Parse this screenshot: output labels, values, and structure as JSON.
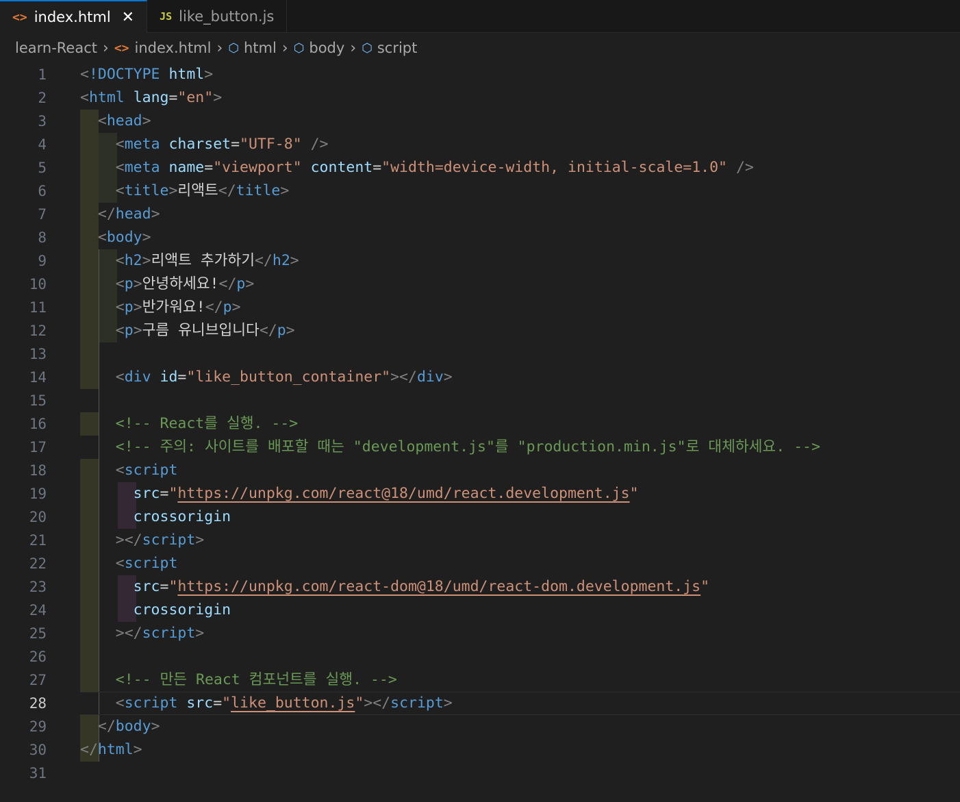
{
  "tabs": [
    {
      "icon": "<>",
      "label": "index.html",
      "close": "✕"
    },
    {
      "icon": "JS",
      "label": "like_button.js"
    }
  ],
  "breadcrumb": [
    "learn-React",
    "index.html",
    "html",
    "body",
    "script"
  ],
  "current_line": 28,
  "lines": [
    {
      "n": 1,
      "p": [
        [
          "pu",
          "<"
        ],
        [
          "tg",
          "!DOCTYPE"
        ],
        [
          "tx",
          " "
        ],
        [
          "at",
          "html"
        ],
        [
          "pu",
          ">"
        ]
      ]
    },
    {
      "n": 2,
      "p": [
        [
          "pu",
          "<"
        ],
        [
          "tg",
          "html"
        ],
        [
          "tx",
          " "
        ],
        [
          "at",
          "lang"
        ],
        [
          "tx",
          "="
        ],
        [
          "st",
          "\"en\""
        ],
        [
          "pu",
          ">"
        ]
      ]
    },
    {
      "n": 3,
      "p": [
        [
          "tx",
          "  "
        ],
        [
          "pu",
          "<"
        ],
        [
          "tg",
          "head"
        ],
        [
          "pu",
          ">"
        ]
      ]
    },
    {
      "n": 4,
      "p": [
        [
          "tx",
          "    "
        ],
        [
          "pu",
          "<"
        ],
        [
          "tg",
          "meta"
        ],
        [
          "tx",
          " "
        ],
        [
          "at",
          "charset"
        ],
        [
          "tx",
          "="
        ],
        [
          "st",
          "\"UTF-8\""
        ],
        [
          "tx",
          " "
        ],
        [
          "pu",
          "/>"
        ]
      ]
    },
    {
      "n": 5,
      "p": [
        [
          "tx",
          "    "
        ],
        [
          "pu",
          "<"
        ],
        [
          "tg",
          "meta"
        ],
        [
          "tx",
          " "
        ],
        [
          "at",
          "name"
        ],
        [
          "tx",
          "="
        ],
        [
          "st",
          "\"viewport\""
        ],
        [
          "tx",
          " "
        ],
        [
          "at",
          "content"
        ],
        [
          "tx",
          "="
        ],
        [
          "st",
          "\"width=device-width, initial-scale=1.0\""
        ],
        [
          "tx",
          " "
        ],
        [
          "pu",
          "/>"
        ]
      ]
    },
    {
      "n": 6,
      "p": [
        [
          "tx",
          "    "
        ],
        [
          "pu",
          "<"
        ],
        [
          "tg",
          "title"
        ],
        [
          "pu",
          ">"
        ],
        [
          "tx",
          "리액트"
        ],
        [
          "pu",
          "</"
        ],
        [
          "tg",
          "title"
        ],
        [
          "pu",
          ">"
        ]
      ]
    },
    {
      "n": 7,
      "p": [
        [
          "tx",
          "  "
        ],
        [
          "pu",
          "</"
        ],
        [
          "tg",
          "head"
        ],
        [
          "pu",
          ">"
        ]
      ]
    },
    {
      "n": 8,
      "p": [
        [
          "tx",
          "  "
        ],
        [
          "pu",
          "<"
        ],
        [
          "tg",
          "body"
        ],
        [
          "pu",
          ">"
        ]
      ]
    },
    {
      "n": 9,
      "p": [
        [
          "tx",
          "    "
        ],
        [
          "pu",
          "<"
        ],
        [
          "tg",
          "h2"
        ],
        [
          "pu",
          ">"
        ],
        [
          "tx",
          "리액트 추가하기"
        ],
        [
          "pu",
          "</"
        ],
        [
          "tg",
          "h2"
        ],
        [
          "pu",
          ">"
        ]
      ]
    },
    {
      "n": 10,
      "p": [
        [
          "tx",
          "    "
        ],
        [
          "pu",
          "<"
        ],
        [
          "tg",
          "p"
        ],
        [
          "pu",
          ">"
        ],
        [
          "tx",
          "안녕하세요!"
        ],
        [
          "pu",
          "</"
        ],
        [
          "tg",
          "p"
        ],
        [
          "pu",
          ">"
        ]
      ]
    },
    {
      "n": 11,
      "p": [
        [
          "tx",
          "    "
        ],
        [
          "pu",
          "<"
        ],
        [
          "tg",
          "p"
        ],
        [
          "pu",
          ">"
        ],
        [
          "tx",
          "반가워요!"
        ],
        [
          "pu",
          "</"
        ],
        [
          "tg",
          "p"
        ],
        [
          "pu",
          ">"
        ]
      ]
    },
    {
      "n": 12,
      "p": [
        [
          "tx",
          "    "
        ],
        [
          "pu",
          "<"
        ],
        [
          "tg",
          "p"
        ],
        [
          "pu",
          ">"
        ],
        [
          "tx",
          "구름 유니브입니다"
        ],
        [
          "pu",
          "</"
        ],
        [
          "tg",
          "p"
        ],
        [
          "pu",
          ">"
        ]
      ]
    },
    {
      "n": 13,
      "p": []
    },
    {
      "n": 14,
      "p": [
        [
          "tx",
          "    "
        ],
        [
          "pu",
          "<"
        ],
        [
          "tg",
          "div"
        ],
        [
          "tx",
          " "
        ],
        [
          "at",
          "id"
        ],
        [
          "tx",
          "="
        ],
        [
          "st",
          "\"like_button_container\""
        ],
        [
          "pu",
          "></"
        ],
        [
          "tg",
          "div"
        ],
        [
          "pu",
          ">"
        ]
      ]
    },
    {
      "n": 15,
      "p": []
    },
    {
      "n": 16,
      "p": [
        [
          "tx",
          "    "
        ],
        [
          "cm",
          "<!-- React를 실행. -->"
        ]
      ]
    },
    {
      "n": 17,
      "p": [
        [
          "tx",
          "    "
        ],
        [
          "cm",
          "<!-- 주의: 사이트를 배포할 때는 \"development.js\"를 \"production.min.js\"로 대체하세요. -->"
        ]
      ]
    },
    {
      "n": 18,
      "p": [
        [
          "tx",
          "    "
        ],
        [
          "pu",
          "<"
        ],
        [
          "tg",
          "script"
        ]
      ]
    },
    {
      "n": 19,
      "p": [
        [
          "tx",
          "      "
        ],
        [
          "at",
          "src"
        ],
        [
          "tx",
          "="
        ],
        [
          "st",
          "\""
        ],
        [
          "st u",
          "https://unpkg.com/react@18/umd/react.development.js"
        ],
        [
          "st",
          "\""
        ]
      ]
    },
    {
      "n": 20,
      "p": [
        [
          "tx",
          "      "
        ],
        [
          "at",
          "crossorigin"
        ]
      ]
    },
    {
      "n": 21,
      "p": [
        [
          "tx",
          "    "
        ],
        [
          "pu",
          "></"
        ],
        [
          "tg",
          "script"
        ],
        [
          "pu",
          ">"
        ]
      ]
    },
    {
      "n": 22,
      "p": [
        [
          "tx",
          "    "
        ],
        [
          "pu",
          "<"
        ],
        [
          "tg",
          "script"
        ]
      ]
    },
    {
      "n": 23,
      "p": [
        [
          "tx",
          "      "
        ],
        [
          "at",
          "src"
        ],
        [
          "tx",
          "="
        ],
        [
          "st",
          "\""
        ],
        [
          "st u",
          "https://unpkg.com/react-dom@18/umd/react-dom.development.js"
        ],
        [
          "st",
          "\""
        ]
      ]
    },
    {
      "n": 24,
      "p": [
        [
          "tx",
          "      "
        ],
        [
          "at",
          "crossorigin"
        ]
      ]
    },
    {
      "n": 25,
      "p": [
        [
          "tx",
          "    "
        ],
        [
          "pu",
          "></"
        ],
        [
          "tg",
          "script"
        ],
        [
          "pu",
          ">"
        ]
      ]
    },
    {
      "n": 26,
      "p": []
    },
    {
      "n": 27,
      "p": [
        [
          "tx",
          "    "
        ],
        [
          "cm",
          "<!-- 만든 React 컴포넌트를 실행. -->"
        ]
      ]
    },
    {
      "n": 28,
      "p": [
        [
          "tx",
          "    "
        ],
        [
          "pu",
          "<"
        ],
        [
          "tg",
          "script"
        ],
        [
          "tx",
          " "
        ],
        [
          "at",
          "src"
        ],
        [
          "tx",
          "="
        ],
        [
          "st",
          "\""
        ],
        [
          "st u",
          "like_button.js"
        ],
        [
          "st",
          "\""
        ],
        [
          "pu",
          "></"
        ],
        [
          "tg",
          "script"
        ],
        [
          "pu",
          ">"
        ]
      ]
    },
    {
      "n": 29,
      "p": [
        [
          "tx",
          "  "
        ],
        [
          "pu",
          "</"
        ],
        [
          "tg",
          "body"
        ],
        [
          "pu",
          ">"
        ]
      ]
    },
    {
      "n": 30,
      "p": [
        [
          "pu",
          "</"
        ],
        [
          "tg",
          "html"
        ],
        [
          "pu",
          ">"
        ]
      ]
    },
    {
      "n": 31,
      "p": []
    }
  ]
}
